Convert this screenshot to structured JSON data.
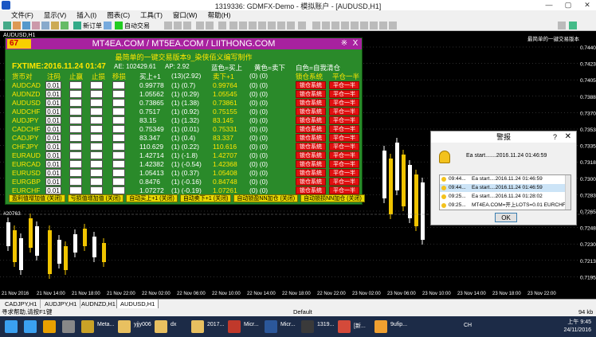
{
  "window": {
    "title": "1319336: GDMFX-Demo - 模拟账户 - [AUDUSD,H1]",
    "min": "—",
    "max": "▢",
    "close": "✕"
  },
  "menu": [
    "文件(F)",
    "显示(V)",
    "插入(I)",
    "图表(C)",
    "工具(T)",
    "窗口(W)",
    "帮助(H)"
  ],
  "toolbar": {
    "new_order": "新订单",
    "auto_trading": "自动交易"
  },
  "chart": {
    "symbol_label": "AUDUSD,H1",
    "top_right_label": "最简单的一键交易版本",
    "price_label": "#20763",
    "prices": [
      "0.74405",
      "0.74230",
      "0.74055",
      "0.73880",
      "0.73705",
      "0.73530",
      "0.73355",
      "0.73180",
      "0.73005",
      "0.72830",
      "0.72655",
      "0.72480",
      "0.72305",
      "0.72130",
      "0.71955"
    ],
    "dates": [
      "21 Nov 2016",
      "21 Nov 14:00",
      "21 Nov 18:00",
      "21 Nov 22:00",
      "22 Nov 02:00",
      "22 Nov 06:00",
      "22 Nov 10:00",
      "22 Nov 14:00",
      "22 Nov 18:00",
      "22 Nov 22:00",
      "23 Nov 02:00",
      "23 Nov 06:00",
      "23 Nov 10:00",
      "23 Nov 14:00",
      "23 Nov 18:00",
      "23 Nov 22:00"
    ],
    "colors": {
      "bull": "#ffffff",
      "bear": "#f0c400",
      "grid": "#5a5a5a"
    }
  },
  "ea_panel": {
    "badge": "67",
    "title": "MT4EA.COM / MT5EA.COM / LIITHONG.COM",
    "subtitle": "最简单的一键交易版本9_染侠佰义编写制作",
    "time": "FXTIME:2016.11.24 01:47",
    "ae": "AE: 102429.61",
    "ap": "AP: 2.92",
    "blue_label": "蓝色=买上",
    "yellow_label": "黄色=卖下",
    "white_label": "白色=自我清仓",
    "headers": {
      "symbol": "货币对",
      "lots": "注码",
      "sl": "止赢",
      "tp": "止损",
      "move": "移损",
      "buy": "买上+1",
      "stat": "(13)(2.92)",
      "sell": "卖下+1",
      "zero": "(0) (0)",
      "lock": "锁仓系统",
      "close_half": "平仓一半"
    },
    "rows": [
      {
        "symbol": "AUDCAD",
        "lots": "0.01",
        "buy": "0.99778",
        "bstat": "(1) (0.7)",
        "sell": "0.99764",
        "sstat": "(0) (0)"
      },
      {
        "symbol": "AUDNZD",
        "lots": "0.01",
        "buy": "1.05562",
        "bstat": "(1) (0.29)",
        "sell": "1.05545",
        "sstat": "(0) (0)"
      },
      {
        "symbol": "AUDUSD",
        "lots": "0.01",
        "buy": "0.73865",
        "bstat": "(1) (1.38)",
        "sell": "0.73861",
        "sstat": "(0) (0)"
      },
      {
        "symbol": "AUDCHF",
        "lots": "0.01",
        "buy": "0.7517",
        "bstat": "(1) (0.92)",
        "sell": "0.75155",
        "sstat": "(0) (0)"
      },
      {
        "symbol": "AUDJPY",
        "lots": "0.01",
        "buy": "83.15",
        "bstat": "(1) (1.32)",
        "sell": "83.145",
        "sstat": "(0) (0)"
      },
      {
        "symbol": "CADCHF",
        "lots": "0.01",
        "buy": "0.75349",
        "bstat": "(1) (0.01)",
        "sell": "0.75331",
        "sstat": "(0) (0)"
      },
      {
        "symbol": "CADJPY",
        "lots": "0.01",
        "buy": "83.347",
        "bstat": "(1) (0.4)",
        "sell": "83.337",
        "sstat": "(0) (0)"
      },
      {
        "symbol": "CHFJPY",
        "lots": "0.01",
        "buy": "110.629",
        "bstat": "(1) (0.22)",
        "sell": "110.616",
        "sstat": "(0) (0)"
      },
      {
        "symbol": "EURAUD",
        "lots": "0.01",
        "buy": "1.42714",
        "bstat": "(1) (-1.8)",
        "sell": "1.42707",
        "sstat": "(0) (0)"
      },
      {
        "symbol": "EURCAD",
        "lots": "0.01",
        "buy": "1.42382",
        "bstat": "(1) (-0.54)",
        "sell": "1.42368",
        "sstat": "(0) (0)"
      },
      {
        "symbol": "EURUSD",
        "lots": "0.01",
        "buy": "1.05413",
        "bstat": "(1) (0.37)",
        "sell": "1.05408",
        "sstat": "(0) (0)"
      },
      {
        "symbol": "EURGBP",
        "lots": "0.01",
        "buy": "0.8476",
        "bstat": "(1) (-0.16)",
        "sell": "0.84748",
        "sstat": "(0) (0)"
      },
      {
        "symbol": "EURCHF",
        "lots": "0.01",
        "buy": "1.07272",
        "bstat": "(1) (-0.19)",
        "sell": "1.07261",
        "sstat": "(0) (0)"
      }
    ],
    "lock_btn": "锁仓系统",
    "half_btn": "平仓一半",
    "bottom_buttons": [
      "盈利值增加值 (关闭)",
      "亏损值增加值 (关闭)",
      "自动买上+1 (关闭)",
      "自动卖下+1 (关闭)",
      "自动锁盈NN加仓 (关闭)",
      "自动锁损NN加仓 (关闭)"
    ]
  },
  "alert": {
    "title": "警报",
    "help": "?",
    "close": "✕",
    "message": "Ea start.......2016.11.24 01:46:59",
    "items": [
      {
        "time": "09:44...",
        "text": "Ea start....2016.11.24 01:46:59"
      },
      {
        "time": "09:44...",
        "text": "Ea start....2016.11.24 01:46:59"
      },
      {
        "time": "09:25...",
        "text": "Ea start....2016.11.24 01:28:02"
      },
      {
        "time": "09:25...",
        "text": "MT4EA.COM=开上LOTS=0.01 EURCHF"
      }
    ],
    "ok": "OK"
  },
  "chart_tabs": [
    "CADJPY,H1",
    "AUDJPY,H1",
    "AUDNZD,H1",
    "AUDUSD,H1"
  ],
  "status": {
    "help": "寻求帮助,请按F1键",
    "profile": "Default",
    "traffic": "94 kb"
  },
  "taskbar": {
    "items": [
      {
        "label": "",
        "color": "#3aa0f0"
      },
      {
        "label": "",
        "color": "#e8a000"
      },
      {
        "label": "",
        "color": "#888888"
      },
      {
        "label": "Meta...",
        "color": "#c9a227"
      },
      {
        "label": "yjjy006",
        "color": "#e8c060"
      },
      {
        "label": "dx",
        "color": "#e8c060"
      },
      {
        "label": "2017...",
        "color": "#e8c060"
      },
      {
        "label": "Micr...",
        "color": "#c0392b"
      },
      {
        "label": "Micr...",
        "color": "#2b579a"
      },
      {
        "label": "1319...",
        "color": "#3a3a3a"
      },
      {
        "label": "[新...",
        "color": "#d44a3a"
      },
      {
        "label": "9ufip...",
        "color": "#f0a030"
      }
    ],
    "lang": "CH",
    "time": "上午 9:45",
    "date": "24/11/2016"
  }
}
